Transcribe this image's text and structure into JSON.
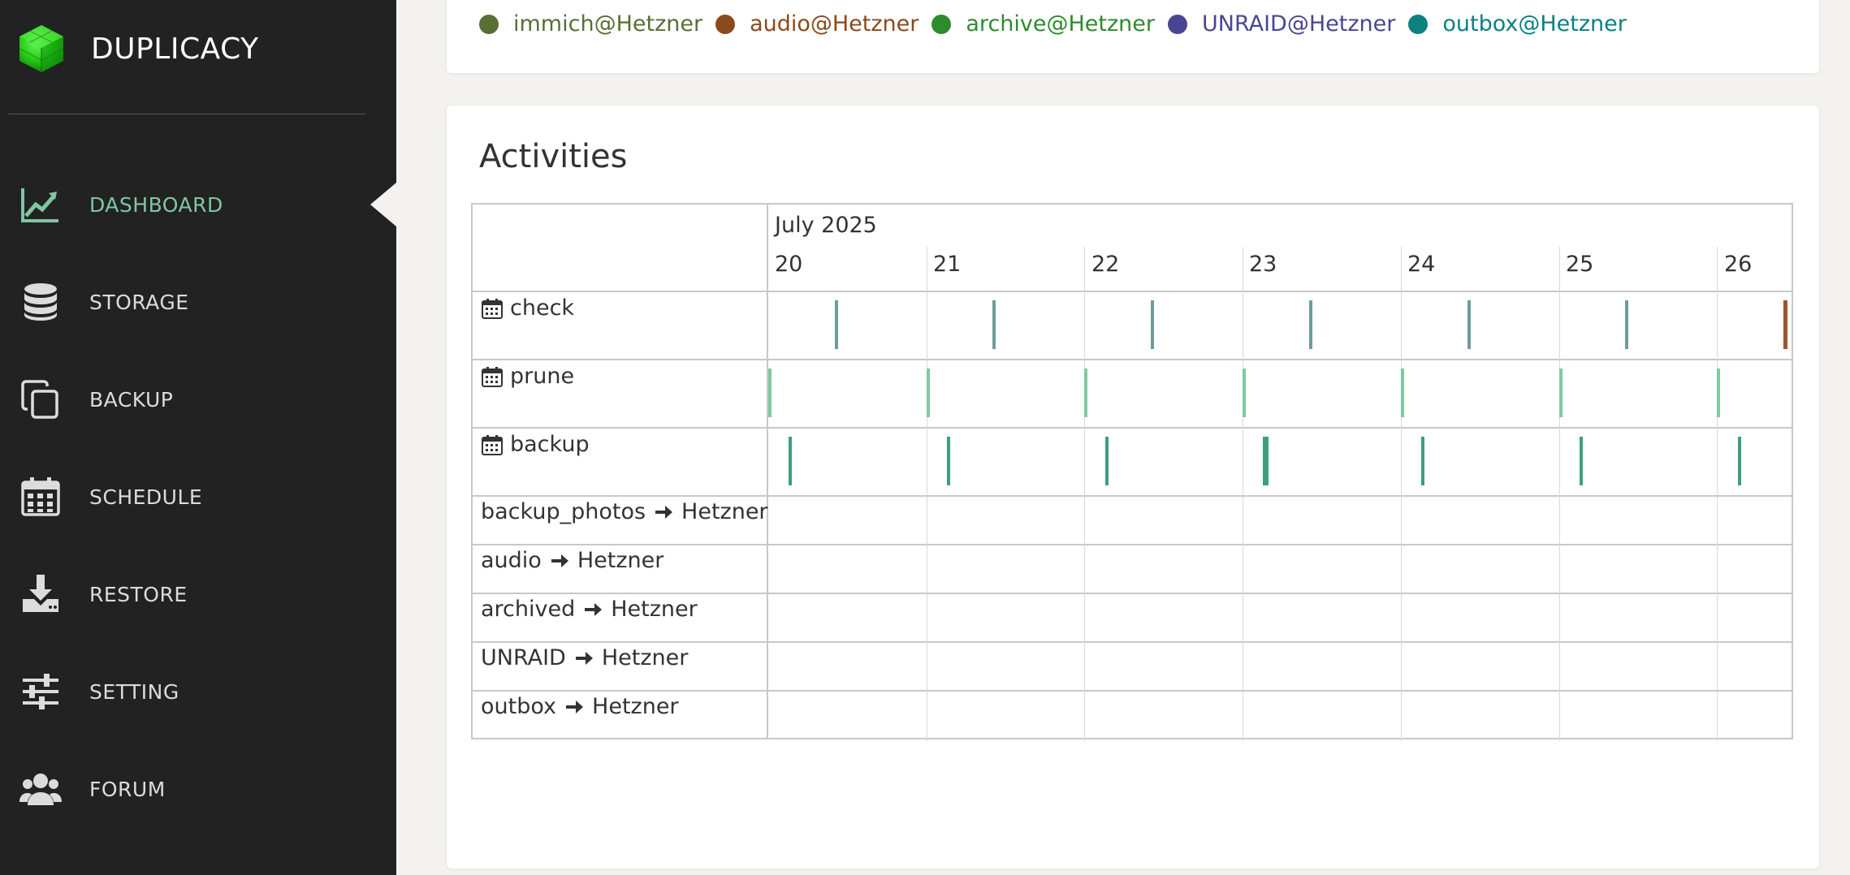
{
  "app": {
    "name": "DUPLICACY"
  },
  "nav": {
    "items": [
      {
        "label": "DASHBOARD",
        "icon": "chart-line-icon",
        "active": true
      },
      {
        "label": "STORAGE",
        "icon": "database-icon",
        "active": false
      },
      {
        "label": "BACKUP",
        "icon": "copy-icon",
        "active": false
      },
      {
        "label": "SCHEDULE",
        "icon": "calendar-icon",
        "active": false
      },
      {
        "label": "RESTORE",
        "icon": "download-icon",
        "active": false
      },
      {
        "label": "SETTING",
        "icon": "sliders-icon",
        "active": false
      },
      {
        "label": "FORUM",
        "icon": "users-icon",
        "active": false
      }
    ]
  },
  "legend": [
    {
      "label": "immich@Hetzner",
      "color": "#5a6e34"
    },
    {
      "label": "audio@Hetzner",
      "color": "#8b4a1c"
    },
    {
      "label": "archive@Hetzner",
      "color": "#2e8b2e"
    },
    {
      "label": "UNRAID@Hetzner",
      "color": "#4a4593"
    },
    {
      "label": "outbox@Hetzner",
      "color": "#0d8080"
    }
  ],
  "activities": {
    "title": "Activities",
    "month": "July 2025",
    "days": [
      "20",
      "21",
      "22",
      "23",
      "24",
      "25",
      "26"
    ],
    "rows": [
      {
        "label": "check",
        "type": "schedule"
      },
      {
        "label": "prune",
        "type": "schedule"
      },
      {
        "label": "backup",
        "type": "schedule"
      },
      {
        "source": "backup_photos",
        "target": "Hetzner",
        "type": "job"
      },
      {
        "source": "audio",
        "target": "Hetzner",
        "type": "job"
      },
      {
        "source": "archived",
        "target": "Hetzner",
        "type": "job"
      },
      {
        "source": "UNRAID",
        "target": "Hetzner",
        "type": "job"
      },
      {
        "source": "outbox",
        "target": "Hetzner",
        "type": "job"
      }
    ],
    "events": {
      "check": {
        "color": "#6e9c9c",
        "day_offsets": [
          0.42,
          1.42,
          2.42,
          3.42,
          4.42,
          5.42
        ],
        "last": {
          "day_offset": 6.42,
          "color": "#a0522d"
        }
      },
      "prune": {
        "color": "#7fcaa0",
        "day_offsets": [
          0.0,
          1.0,
          2.0,
          3.0,
          4.0,
          5.0,
          6.0
        ]
      },
      "backup": {
        "color": "#3e9e7e",
        "day_offsets": [
          0.13,
          1.13,
          2.13,
          3.13,
          4.13,
          5.13,
          6.13
        ]
      }
    }
  }
}
